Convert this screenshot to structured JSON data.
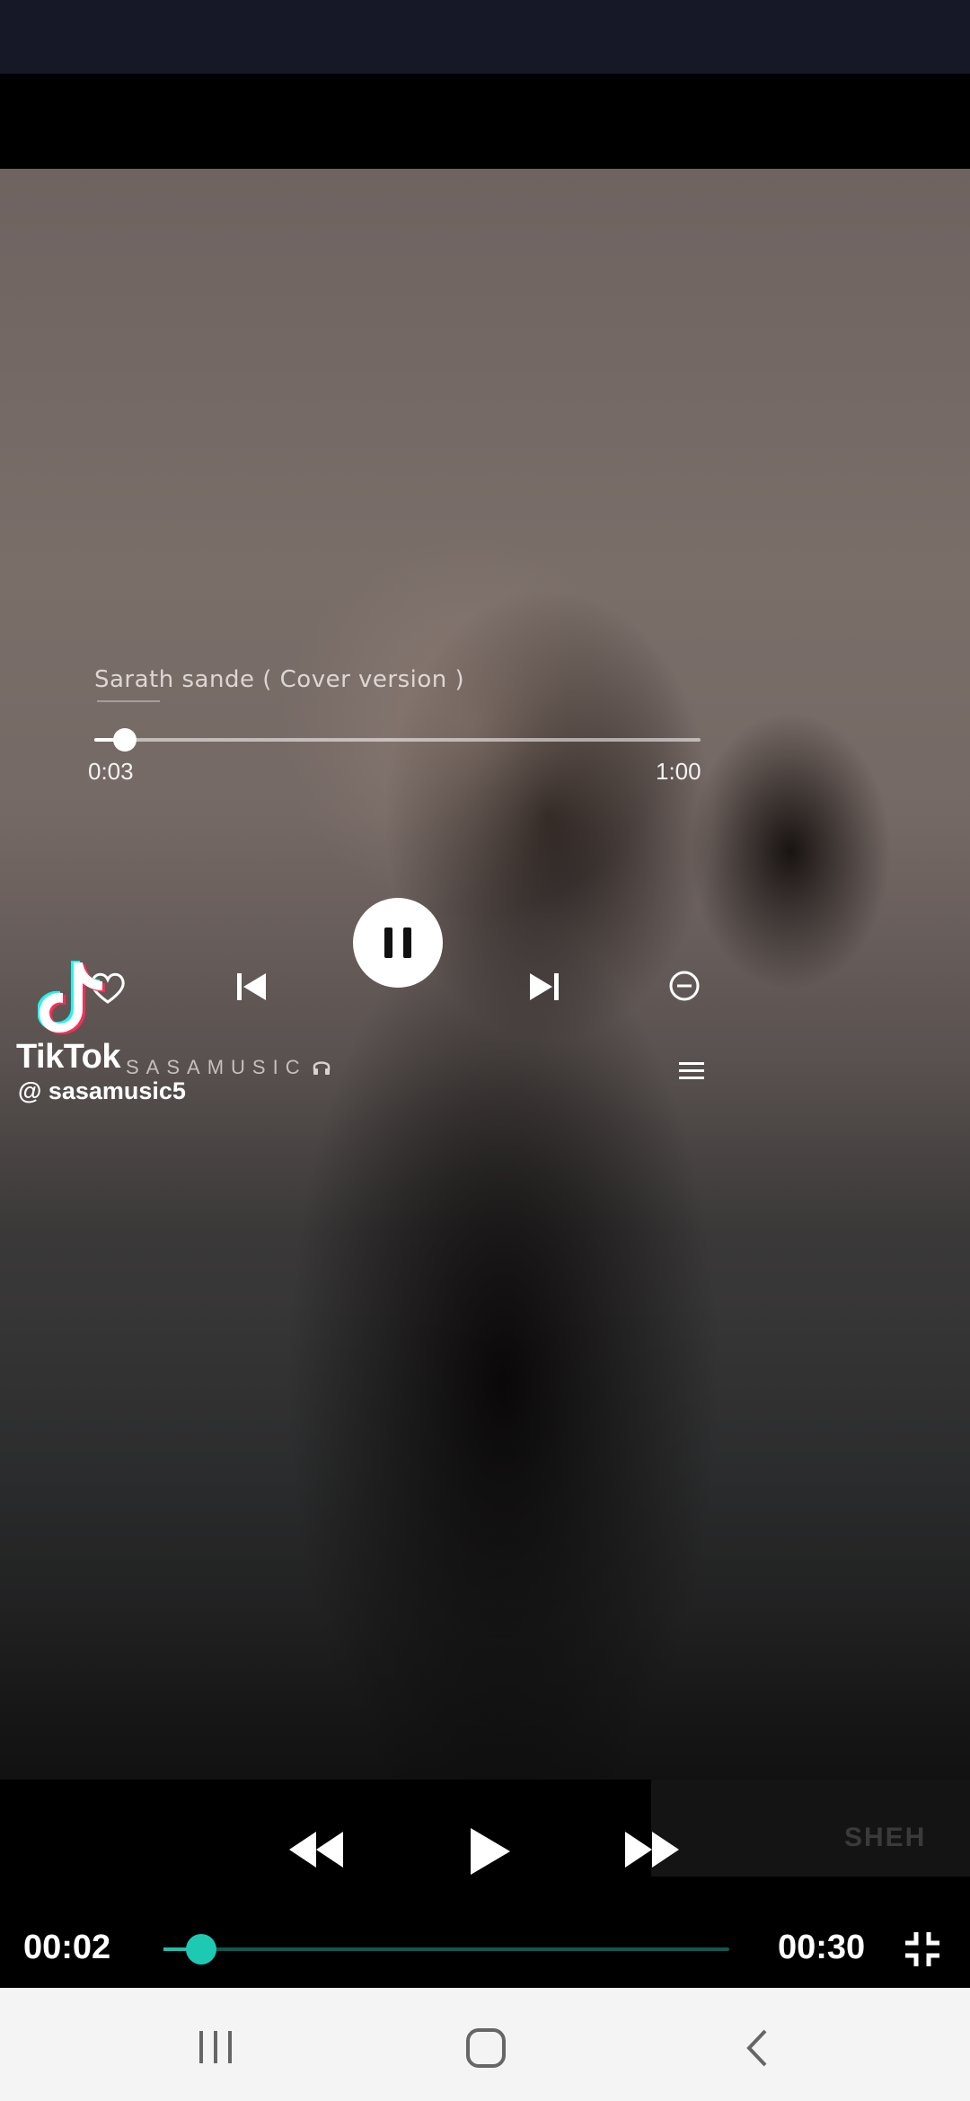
{
  "video_overlay": {
    "song_title": "Sarath sande ( Cover version )",
    "progress": 0.05,
    "time_elapsed": "0:03",
    "time_total": "1:00",
    "brand": "SASAMUSIC",
    "tiktok_wordmark": "TikTok",
    "tiktok_handle": "@ sasamusic5"
  },
  "player": {
    "current_time": "00:02",
    "duration": "00:30",
    "progress": 0.067,
    "watermark": "SHEH"
  },
  "colors": {
    "status_bar": "#171827",
    "accent": "#1ec9b4",
    "track": "#0c5951",
    "nav_bar": "#f4f4f4"
  },
  "icons": {
    "rewind": "rewind-icon",
    "play": "play-icon",
    "forward": "fast-forward-icon",
    "fullscreen_exit": "exit-fullscreen-icon",
    "recents": "recents-icon",
    "home": "home-icon",
    "back": "back-icon"
  }
}
